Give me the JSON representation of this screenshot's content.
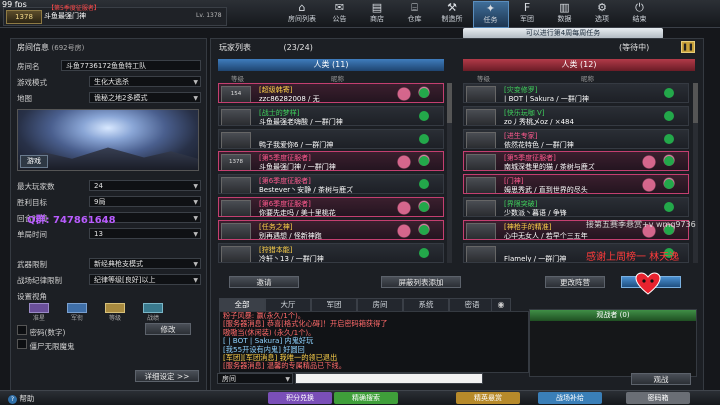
{
  "topbar": {
    "fps": "99 fps",
    "player": {
      "rank": "1378",
      "title": "【第5季度征服者】",
      "name": "斗鱼最强门神",
      "level": "Lv. 1378"
    },
    "menu": [
      {
        "label": "房间列表",
        "icon": "door-icon",
        "glyph": "⌂",
        "active": false
      },
      {
        "label": "公告",
        "icon": "megaphone-icon",
        "glyph": "✉",
        "active": false
      },
      {
        "label": "商店",
        "icon": "shop-icon",
        "glyph": "▤",
        "active": false
      },
      {
        "label": "仓库",
        "icon": "warehouse-icon",
        "glyph": "⌸",
        "active": false
      },
      {
        "label": "制造所",
        "icon": "hammer-icon",
        "glyph": "⚒",
        "active": false
      },
      {
        "label": "任务",
        "icon": "quest-icon",
        "glyph": "✦",
        "active": true
      },
      {
        "label": "军团",
        "icon": "clan-icon",
        "glyph": "F",
        "active": false
      },
      {
        "label": "数据",
        "icon": "data-icon",
        "glyph": "▥",
        "active": false
      },
      {
        "label": "选项",
        "icon": "gear-icon",
        "glyph": "⚙",
        "active": false
      },
      {
        "label": "结束",
        "icon": "power-icon",
        "glyph": "⏻",
        "active": false
      }
    ]
  },
  "notice": "可以进行第4周每周任务",
  "room": {
    "title": "房间信息",
    "count": "(692号房)",
    "name_label": "房间名",
    "name": "斗鱼7736172鱼鱼特工队",
    "mode_label": "游戏模式",
    "mode": "生化大逃杀",
    "map_label": "地图",
    "map": "诡秘之地2多模式",
    "map_btn": "游戏",
    "maxplayers_label": "最大玩家数",
    "maxplayers": "24",
    "win_label": "胜利目标",
    "win": "9局",
    "round_label": "回合时间",
    "round": "",
    "single_label": "单局时间",
    "single": "13",
    "weapon_label": "武器限制",
    "weapon": "新经典枪支模式",
    "discipline_label": "战场纪律限制",
    "discipline": "纪律等级[良好]以上",
    "view_label": "设置视角",
    "views": [
      "准星",
      "军衔",
      "等级",
      "战绩"
    ],
    "password_label": "密码(数字)",
    "password_btn": "修改",
    "observer_label": "僵尸无限魔鬼",
    "detail_btn": "详细设定 >>"
  },
  "players": {
    "title": "玩家列表",
    "count": "(23/24)",
    "status": "(等待中)",
    "left_team": "人类 (11)",
    "right_team": "人类 (12)",
    "col_level": "等级",
    "col_name": "昵称",
    "left": [
      {
        "rank": "154",
        "clan": "[超级韩寄]",
        "name": "zzc86282008 / 无",
        "hl": true,
        "clan_color": "#ffd24a"
      },
      {
        "rank": "",
        "clan": "[战士的梦样]",
        "name": "斗鱼最强老嗨酸 / 一群门神",
        "hl": false,
        "clan_color": "#3fd15c"
      },
      {
        "rank": "",
        "clan": "",
        "name": "鸭子我爱你6 / 一群门神",
        "hl": false,
        "clan_color": "#ddd"
      },
      {
        "rank": "1378",
        "clan": "[第5季度征服者]",
        "name": "斗鱼最强门神 / 一群门神",
        "hl": true,
        "clan_color": "#ff5a8f"
      },
      {
        "rank": "",
        "clan": "[第6季度征服者]",
        "name": "Bestever丶安静 / 茶树与鹿ズ",
        "hl": false,
        "clan_color": "#ff5a8f"
      },
      {
        "rank": "",
        "clan": "[第6季度征服者]",
        "name": "你要先走吗 / 美十里桃花",
        "hl": true,
        "clan_color": "#ff5a8f"
      },
      {
        "rank": "",
        "clan": "[任务之神]",
        "name": "别再遇想 / 怪新神跑",
        "hl": true,
        "clan_color": "#ffd24a"
      },
      {
        "rank": "",
        "clan": "[狩猎本能]",
        "name": "冷轩丶13 / 一群门神",
        "hl": false,
        "clan_color": "#ffd24a"
      }
    ],
    "right": [
      {
        "rank": "",
        "clan": "[灾变修罗]",
        "name": "| BOT | Sakura / 一群门神",
        "hl": false,
        "clan_color": "#3fd15c"
      },
      {
        "rank": "",
        "clan": "[快乐玩咖 V]",
        "name": "zo丿秀桃乄oz / ×484",
        "hl": false,
        "clan_color": "#3fd15c"
      },
      {
        "rank": "",
        "clan": "[进生专家]",
        "name": "依然花特色 / 一群门神",
        "hl": false,
        "clan_color": "#ff5a8f"
      },
      {
        "rank": "",
        "clan": "[第5季度征服者]",
        "name": "南城深巷里的猫 / 茶树与鹿ズ",
        "hl": true,
        "clan_color": "#ff5a8f"
      },
      {
        "rank": "",
        "clan": "[门神]",
        "name": "姆思秀武 / 直到世界的尽头",
        "hl": true,
        "clan_color": "#ff5a8f"
      },
      {
        "rank": "",
        "clan": "[界限突破]",
        "name": "少数派丶暮语 / 争锋",
        "hl": false,
        "clan_color": "#3fd15c"
      },
      {
        "rank": "",
        "clan": "[神枪手的精准]",
        "name": "心中无女人 / 若早个三五年",
        "hl": true,
        "clan_color": "#ffd24a"
      },
      {
        "rank": "",
        "clan": "",
        "name": "Flamely / 一群门神",
        "hl": false,
        "clan_color": "#ddd"
      }
    ],
    "invite_btn": "邀请",
    "add_blocked_btn": "屏蔽列表添加",
    "change_team_btn": "更改阵营",
    "start_btn": "开始"
  },
  "chat": {
    "tabs": [
      "全部",
      "大厅",
      "军团",
      "房间",
      "系统",
      "密语"
    ],
    "lines": [
      {
        "text": "粉子风暴: 赢(永久/1个)。",
        "color": "#ff6a6a"
      },
      {
        "text": "[服务器消息] 恭喜[格式化心碍]！开启密码箱获得了",
        "color": "#ff6a6a"
      },
      {
        "text": "嗷嗷当(休闲装) (永久/1个)。",
        "color": "#ff6a6a"
      },
      {
        "text": "[ | BOT | Sakura] 内鬼好玩",
        "color": "#8fd3ff"
      },
      {
        "text": "[我55开设有内鬼] 好圆回",
        "color": "#8fd3ff"
      },
      {
        "text": "[军团][军团消息] 我唯一的领已退出",
        "color": "#ffd24a"
      },
      {
        "text": "[服务器消息] 温馨的专属精品已下线。",
        "color": "#ff6a6a"
      }
    ],
    "input_select": "房间",
    "input_value": ""
  },
  "observers": {
    "title": "观战者",
    "count": "(0)",
    "btn": "观战"
  },
  "bottom": {
    "help": "帮助",
    "buttons": [
      {
        "label": "积分兑换",
        "color": "#7a4fb8"
      },
      {
        "label": "精确搜索",
        "color": "#3f9f3a"
      },
      {
        "label": "精英悬赏",
        "color": "#b78a2a"
      },
      {
        "label": "战场补给",
        "color": "#3a7fb8"
      },
      {
        "label": "密码箱",
        "color": "#6a6e75"
      }
    ]
  },
  "overlay": {
    "qq": "Q群: 747861648",
    "tag": "接第五赛季悬赏+v wmq9736",
    "thanks": "感谢上周榜一 林天逸"
  },
  "colors": {
    "accent_blue": "#2f6fa8",
    "accent_red": "#9b2b3b",
    "highlight_pink": "#c43f70"
  }
}
